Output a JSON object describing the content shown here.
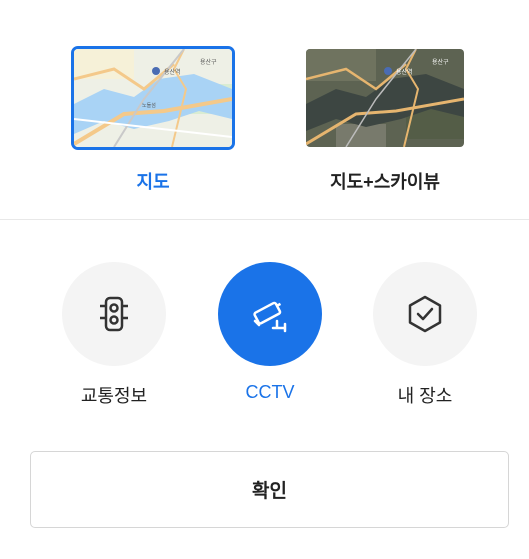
{
  "map_types": [
    {
      "label": "지도",
      "selected": true
    },
    {
      "label": "지도+스카이뷰",
      "selected": false
    }
  ],
  "thumbnail_text": {
    "station": "용산역",
    "district": "용산구",
    "street": "노들섬"
  },
  "layers": [
    {
      "label": "교통정보",
      "icon": "traffic-light-icon",
      "active": false
    },
    {
      "label": "CCTV",
      "icon": "cctv-camera-icon",
      "active": true
    },
    {
      "label": "내 장소",
      "icon": "hexagon-check-icon",
      "active": false
    }
  ],
  "confirm_label": "확인",
  "colors": {
    "accent": "#1a73e8",
    "inactive_circle": "#f4f4f4",
    "text": "#222222"
  }
}
